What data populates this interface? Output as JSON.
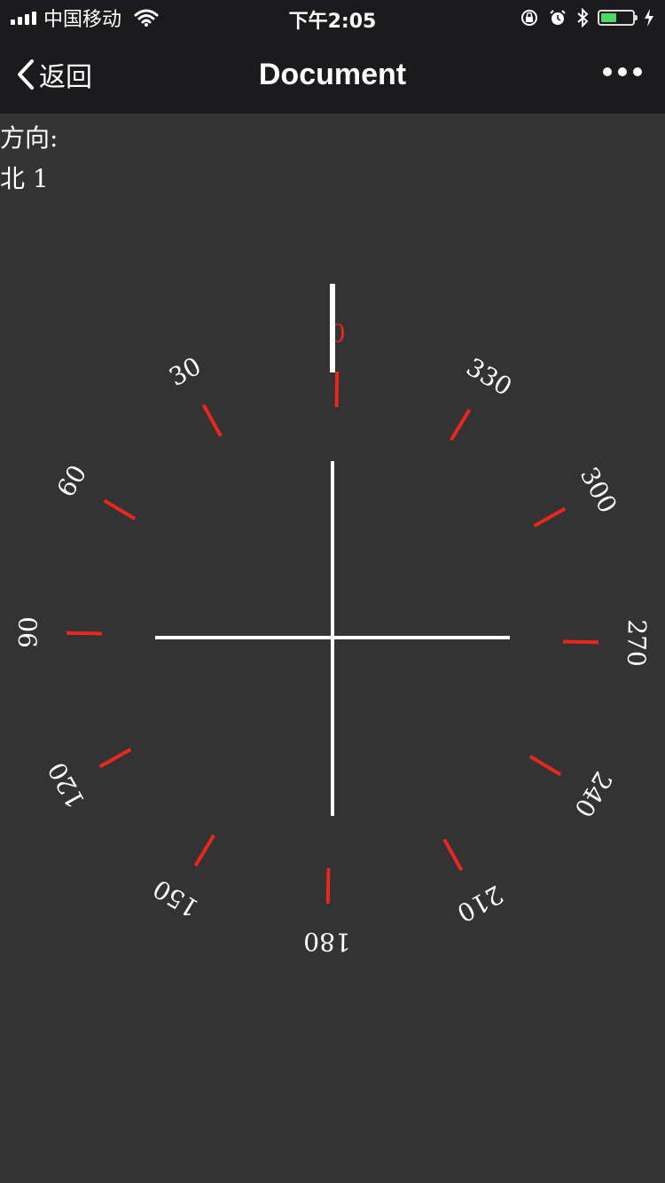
{
  "status_bar": {
    "carrier": "中国移动",
    "time": "下午2:05",
    "battery_level": 0.5,
    "icons": [
      "signal-icon",
      "wifi-icon",
      "orientation-lock-icon",
      "alarm-icon",
      "bluetooth-icon",
      "battery-icon",
      "charging-icon"
    ]
  },
  "nav_bar": {
    "back_label": "返回",
    "title": "Document",
    "back_icon": "chevron-left-icon",
    "more_icon": "more-dots-icon"
  },
  "direction": {
    "label": "方向:",
    "value": "北 1"
  },
  "compass": {
    "heading_degrees": 1,
    "tick_labels": [
      "0",
      "30",
      "60",
      "90",
      "120",
      "150",
      "180",
      "210",
      "240",
      "270",
      "300",
      "330"
    ],
    "colors": {
      "tick": "#e8281e",
      "zero_label": "#e8281e",
      "label": "#ffffff",
      "crosshair": "#ffffff",
      "pointer": "#ffffff",
      "background": "#333333"
    }
  }
}
